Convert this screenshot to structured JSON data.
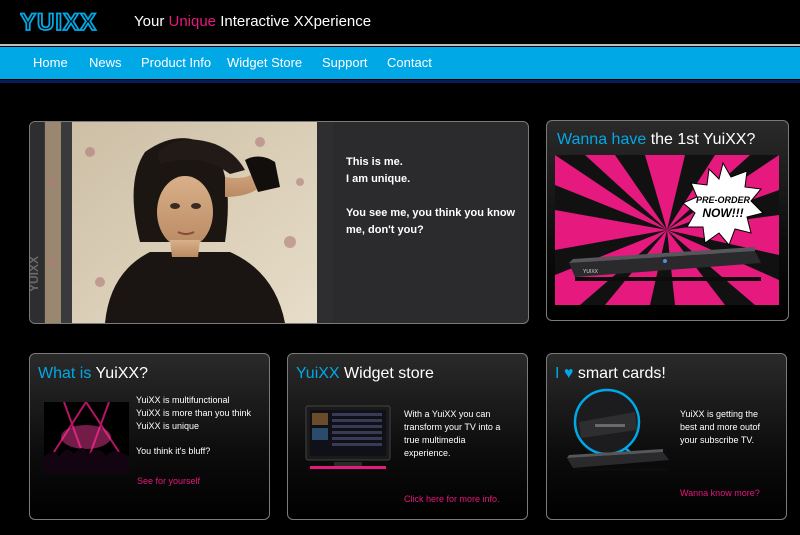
{
  "header": {
    "logo_text": "YUIXX",
    "tagline_pre": "Your ",
    "tagline_accent": "Unique",
    "tagline_post": " Interactive XXperience"
  },
  "nav": {
    "items": [
      {
        "label": "Home",
        "active": true
      },
      {
        "label": "News"
      },
      {
        "label": "Product Info"
      },
      {
        "label": "Widget Store"
      },
      {
        "label": "Support"
      },
      {
        "label": "Contact"
      }
    ]
  },
  "hero": {
    "line1": "This is me.",
    "line2": "I am unique.",
    "line3": "You see me, you think you know me, don't you?",
    "watermark": "YUIXX"
  },
  "preorder": {
    "title_accent": "Wanna have",
    "title_rest": " the 1st YuiXX?",
    "badge_line1": "PRE-ORDER",
    "badge_line2": "NOW!!!",
    "device_label": "YUIXX"
  },
  "cards": [
    {
      "title_a": "What is ",
      "title_b": "YuiXX?",
      "lines": [
        "YuiXX is multifunctional",
        "YuiXX is more than you think",
        "YuiXX is unique"
      ],
      "extra": "You think it's bluff?",
      "link": "See for yourself"
    },
    {
      "title_a": "YuiXX",
      "title_b": " Widget store",
      "lines": [
        "With a YuiXX you can",
        "transform your TV into a",
        "true multimedia",
        "experience."
      ],
      "link": "Click here for more info."
    },
    {
      "title_a": "I ",
      "heart": "♥",
      "title_b": " smart cards!",
      "lines": [
        "YuiXX is getting the",
        "best and more outof",
        "your subscribe TV."
      ],
      "link": "Wanna know more?"
    }
  ],
  "colors": {
    "accent_pink": "#e8177d",
    "accent_blue": "#00a8e6",
    "nav_bg": "#00a8e6"
  }
}
